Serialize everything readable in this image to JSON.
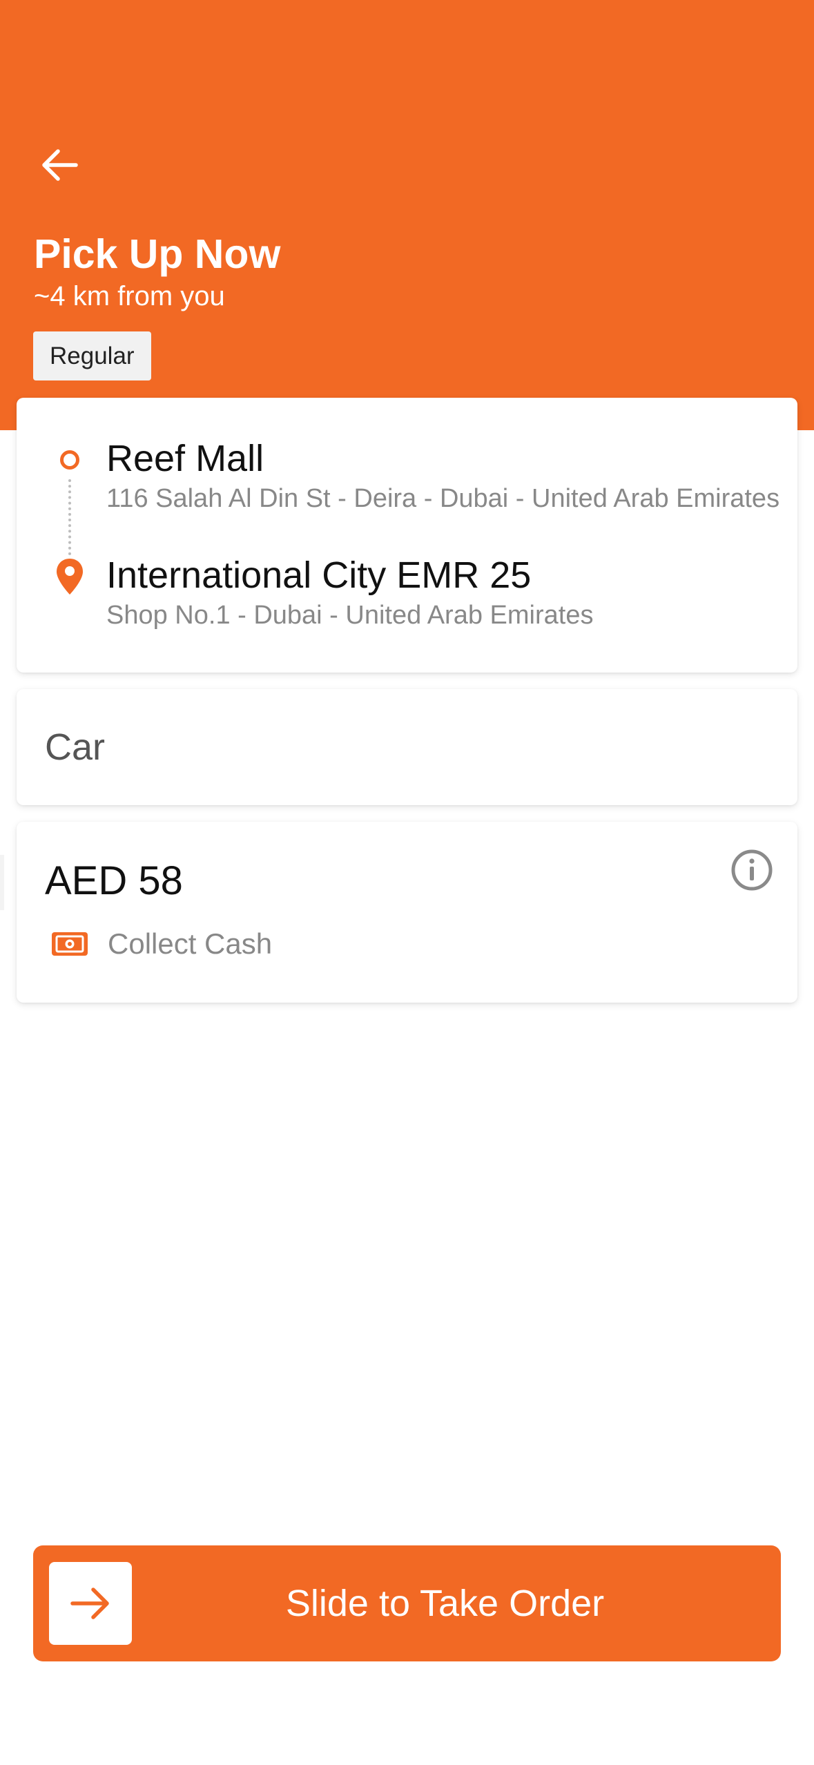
{
  "header": {
    "title": "Pick Up Now",
    "distance": "~4 km from you",
    "badge": "Regular",
    "back_icon": "arrow-left-icon"
  },
  "route": {
    "pickup": {
      "name": "Reef Mall",
      "address": "116 Salah Al Din St - Deira - Dubai - United Arab Emirates"
    },
    "dropoff": {
      "name": "International City EMR 25",
      "address": "Shop No.1 - Dubai - United Arab Emirates"
    }
  },
  "vehicle": {
    "type": "Car"
  },
  "payment": {
    "price": "AED 58",
    "method": "Collect Cash",
    "method_icon": "cash-icon",
    "info_icon": "info-icon"
  },
  "action": {
    "label": "Slide to Take Order",
    "handle_icon": "arrow-right-icon"
  },
  "colors": {
    "brand": "#F26924",
    "text_primary": "#111111",
    "text_secondary": "#888888",
    "badge_bg": "#F1F1F1"
  }
}
